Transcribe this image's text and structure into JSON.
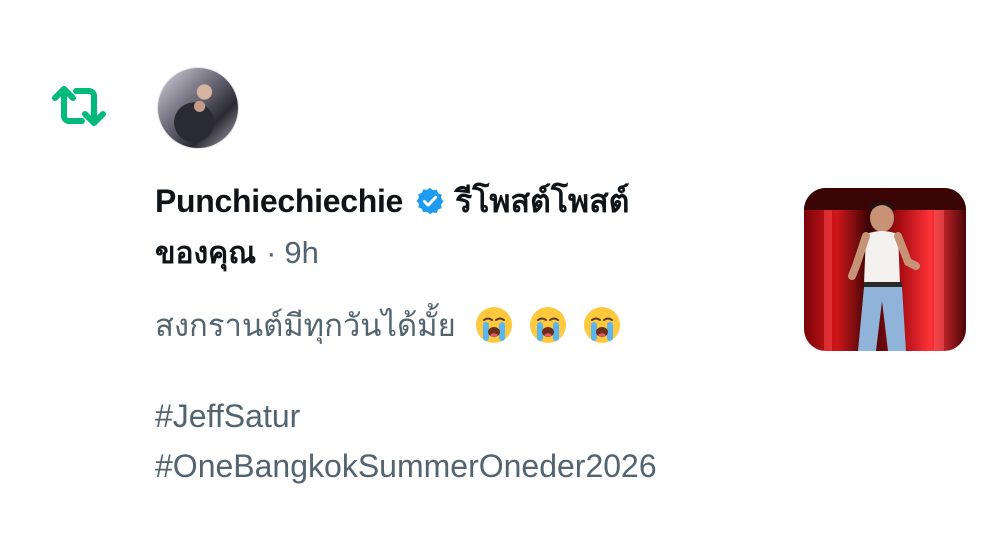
{
  "retweet_indicator": {
    "icon": "retweet-icon",
    "color": "#00ba7c"
  },
  "author": {
    "avatar": "avatar",
    "display_name": "Punchiechiechie",
    "verified_icon": "verified-badge-icon",
    "verified_color": "#1d9bf0"
  },
  "notification": {
    "action_text": "รีโพสต์โพสต์",
    "action_suffix": "ของคุณ",
    "separator": "·",
    "time": "9h"
  },
  "post": {
    "text": "สงกรานต์มีทุกวันได้มั้ย",
    "emojis": [
      "loudly-crying-face-icon",
      "loudly-crying-face-icon",
      "loudly-crying-face-icon"
    ],
    "hashtags": [
      "#JeffSatur",
      "#OneBangkokSummerOneder2026"
    ]
  },
  "media": {
    "thumbnail": "concert-photo-thumbnail"
  },
  "colors": {
    "text_primary": "#0f1419",
    "text_secondary": "#536471",
    "background": "#ffffff"
  }
}
